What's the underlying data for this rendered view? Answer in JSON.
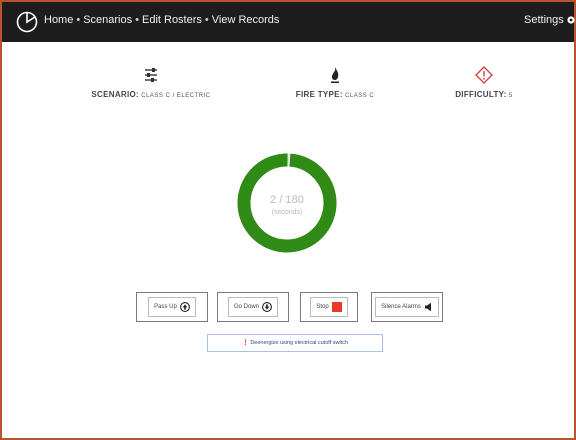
{
  "nav": {
    "items": [
      "Home",
      "Scenarios",
      "Edit Rosters",
      "View Records"
    ],
    "separator": "•",
    "settings_label": "Settings"
  },
  "stats": {
    "scenario": {
      "label": "SCENARIO:",
      "value": "CLASS C / ELECTRIC",
      "icon": "sliders-icon"
    },
    "fire_type": {
      "label": "FIRE TYPE:",
      "value": "CLASS C",
      "icon": "flame-icon"
    },
    "difficulty": {
      "label": "DIFFICULTY:",
      "value": "5",
      "icon": "warning-diamond-icon"
    }
  },
  "timer": {
    "count_text": "2 / 180",
    "unit_text": "(seconds)",
    "elapsed": 2,
    "total": 180,
    "ring_color": "#2f8a16",
    "track_color": "#e6e6e6"
  },
  "controls": {
    "pass_up": "Pass Up",
    "go_down": "Go Down",
    "stop": "Stop",
    "silence": "Silence Alarms"
  },
  "hint": "❗ Deenergize using electrical cutoff switch",
  "colors": {
    "navbar": "#1d1d1d",
    "frame": "#b9542e",
    "stop": "#e8392b",
    "difficulty_icon": "#d23a3a"
  }
}
